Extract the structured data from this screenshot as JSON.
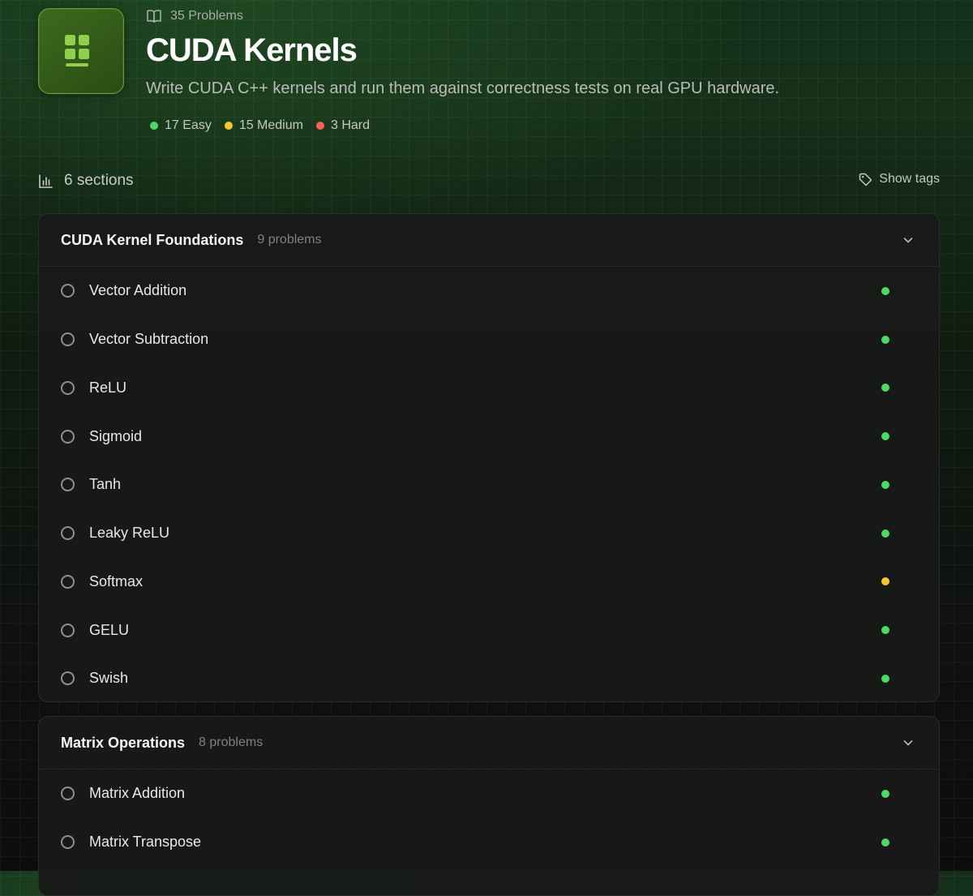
{
  "colors": {
    "easy": "#4cd964",
    "medium": "#f7c530",
    "hard": "#ff5f57"
  },
  "header": {
    "problem_count": "35 Problems",
    "title": "CUDA Kernels",
    "subtitle": "Write CUDA C++ kernels and run them against correctness tests on real GPU hardware.",
    "stats": [
      {
        "label": "17 Easy",
        "color": "#4cd964"
      },
      {
        "label": "15 Medium",
        "color": "#f7c530"
      },
      {
        "label": "3 Hard",
        "color": "#ff5f57"
      }
    ]
  },
  "toolbar": {
    "sections_label": "6 sections",
    "show_tags_label": "Show tags"
  },
  "sections": [
    {
      "title": "CUDA Kernel Foundations",
      "count": "9 problems",
      "problems": [
        {
          "title": "Vector Addition",
          "difficulty": "easy"
        },
        {
          "title": "Vector Subtraction",
          "difficulty": "easy"
        },
        {
          "title": "ReLU",
          "difficulty": "easy"
        },
        {
          "title": "Sigmoid",
          "difficulty": "easy"
        },
        {
          "title": "Tanh",
          "difficulty": "easy"
        },
        {
          "title": "Leaky ReLU",
          "difficulty": "easy"
        },
        {
          "title": "Softmax",
          "difficulty": "medium"
        },
        {
          "title": "GELU",
          "difficulty": "easy"
        },
        {
          "title": "Swish",
          "difficulty": "easy"
        }
      ]
    },
    {
      "title": "Matrix Operations",
      "count": "8 problems",
      "problems": [
        {
          "title": "Matrix Addition",
          "difficulty": "easy"
        },
        {
          "title": "Matrix Transpose",
          "difficulty": "easy"
        }
      ]
    }
  ]
}
